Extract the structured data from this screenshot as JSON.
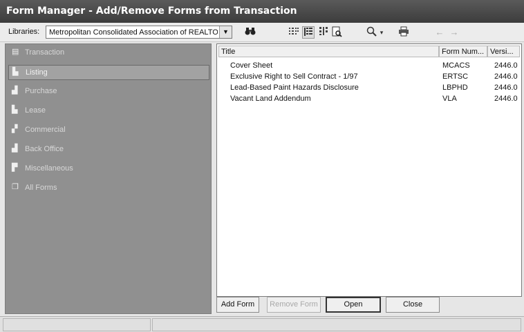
{
  "window": {
    "title": "Form Manager - Add/Remove Forms from Transaction"
  },
  "toolbar": {
    "libraries_label": "Libraries:",
    "libraries_value": "Metropolitan Consolidated Association of REALTORS",
    "icons": [
      "binoculars-icon",
      "list-view-icon",
      "details-view-icon",
      "thumbnail-view-icon",
      "preview-icon",
      "zoom-icon",
      "print-icon",
      "back-arrow-icon",
      "forward-arrow-icon"
    ]
  },
  "sidebar": {
    "items": [
      {
        "label": "Transaction",
        "icon": "transaction-icon"
      },
      {
        "label": "Listing",
        "icon": "listing-icon"
      },
      {
        "label": "Purchase",
        "icon": "purchase-icon"
      },
      {
        "label": "Lease",
        "icon": "lease-icon"
      },
      {
        "label": "Commercial",
        "icon": "commercial-icon"
      },
      {
        "label": "Back Office",
        "icon": "back-office-icon"
      },
      {
        "label": "Miscellaneous",
        "icon": "miscellaneous-icon"
      },
      {
        "label": "All Forms",
        "icon": "all-forms-icon"
      }
    ],
    "selected": "Listing"
  },
  "forms_table": {
    "columns": [
      "Title",
      "Form Num...",
      "Versi..."
    ],
    "rows": [
      {
        "title": "Cover Sheet",
        "form_num": "MCACS",
        "version": "2446.0"
      },
      {
        "title": "Exclusive Right to Sell Contract - 1/97",
        "form_num": "ERTSC",
        "version": "2446.0"
      },
      {
        "title": "Lead-Based Paint Hazards Disclosure",
        "form_num": "LBPHD",
        "version": "2446.0"
      },
      {
        "title": "Vacant Land Addendum",
        "form_num": "VLA",
        "version": "2446.0"
      }
    ]
  },
  "buttons": {
    "add_form": "Add Form",
    "remove_form": "Remove Form",
    "open": "Open",
    "close": "Close"
  }
}
